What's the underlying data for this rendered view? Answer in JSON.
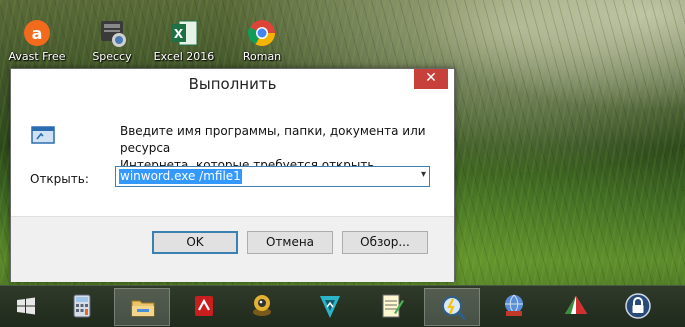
{
  "desktop": {
    "icons": [
      {
        "label": "Avast Free",
        "icon": "avast-icon"
      },
      {
        "label": "Speccy",
        "icon": "speccy-icon"
      },
      {
        "label": "Excel 2016",
        "icon": "excel-icon"
      },
      {
        "label": "Roman",
        "icon": "chrome-icon"
      }
    ]
  },
  "dialog": {
    "title": "Выполнить",
    "close_label": "✕",
    "description_line1": "Введите имя программы, папки, документа или ресурса",
    "description_line2": "Интернета, которые требуется открыть.",
    "open_label": "Открыть:",
    "open_value": "winword.exe /mfile1",
    "dropdown_arrow": "▾",
    "buttons": {
      "ok": "OK",
      "cancel": "Отмена",
      "browse": "Обзор..."
    }
  },
  "taskbar": {
    "items": [
      {
        "icon": "windows-start-icon"
      },
      {
        "icon": "calculator-icon"
      },
      {
        "icon": "file-explorer-icon",
        "active": true
      },
      {
        "icon": "pdf-app-icon"
      },
      {
        "icon": "webcam-icon"
      },
      {
        "icon": "media-player-icon"
      },
      {
        "icon": "notepad-icon"
      },
      {
        "icon": "process-monitor-icon",
        "active": true
      },
      {
        "icon": "network-app-icon"
      },
      {
        "icon": "browser-app-icon"
      },
      {
        "icon": "lock-icon"
      }
    ]
  },
  "colors": {
    "close_button": "#c7413a",
    "selection": "#3399ff",
    "focus_border": "#3c7fb1"
  }
}
